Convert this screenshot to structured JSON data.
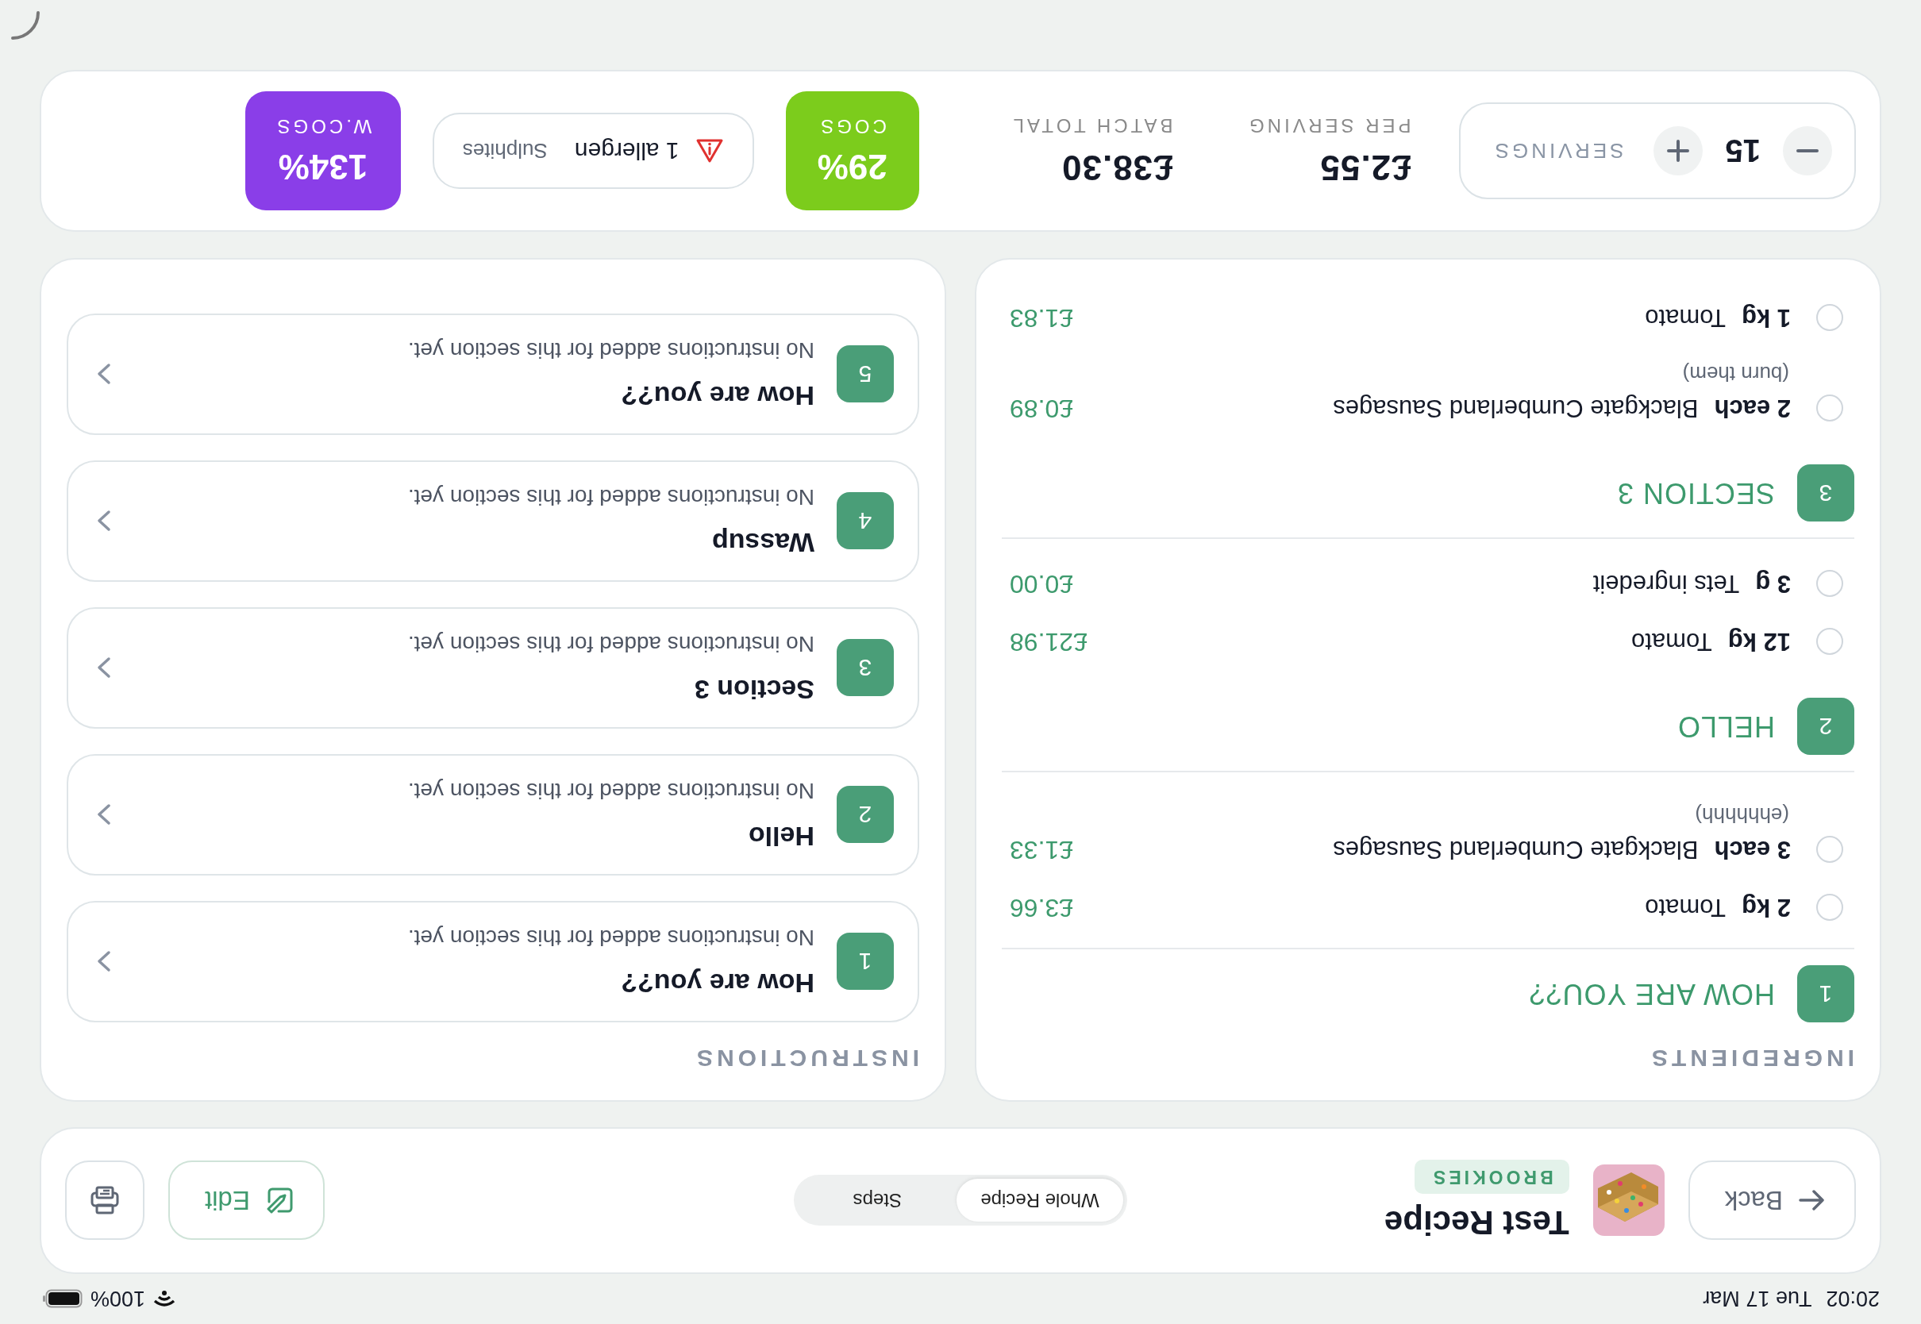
{
  "status_bar": {
    "time": "20:02",
    "date": "Tue 17 Mar",
    "battery": "100%"
  },
  "header": {
    "back": "Back",
    "category": "BROOKIES",
    "title": "Test Recipe",
    "view_tabs": [
      {
        "label": "Whole Recipe",
        "selected": true
      },
      {
        "label": "Steps",
        "selected": false
      }
    ],
    "edit": "Edit"
  },
  "ingredients": {
    "heading": "INGREDIENTS",
    "sections": [
      {
        "number": "1",
        "title": "HOW ARE YOU??",
        "items": [
          {
            "quantity": "2 kg",
            "name": "Tomato",
            "price": "£3.66",
            "checked": false
          },
          {
            "quantity": "3 each",
            "name": "Blackgate Cumberland Sausages",
            "note": "(ehhhhhh)",
            "price": "£1.33",
            "checked": false
          }
        ]
      },
      {
        "number": "2",
        "title": "HELLO",
        "items": [
          {
            "quantity": "12 kg",
            "name": "Tomato",
            "price": "£21.98",
            "checked": false
          },
          {
            "quantity": "3 g",
            "name": "Tets ingredeit",
            "price": "£0.00",
            "checked": false
          }
        ]
      },
      {
        "number": "3",
        "title": "SECTION 3",
        "items": [
          {
            "quantity": "2 each",
            "name": "Blackgate Cumberland Sausages",
            "note": "(burn them)",
            "price": "£0.89",
            "checked": false
          },
          {
            "quantity": "1 kg",
            "name": "Tomato",
            "price": "£1.83",
            "checked": false
          }
        ]
      }
    ]
  },
  "instructions": {
    "heading": "INSTRUCTIONS",
    "steps": [
      {
        "number": "1",
        "title": "How are you??",
        "text": "No instructions added for this section yet.",
        "expanded": false
      },
      {
        "number": "2",
        "title": "Hello",
        "text": "No instructions added for this section yet.",
        "expanded": false
      },
      {
        "number": "3",
        "title": "Section 3",
        "text": "No instructions added for this section yet.",
        "expanded": false
      },
      {
        "number": "4",
        "title": "Wassup",
        "text": "No instructions added for this section yet.",
        "expanded": false
      },
      {
        "number": "5",
        "title": "How are you??",
        "text": "No instructions added for this section yet.",
        "expanded": false
      }
    ]
  },
  "summary": {
    "servings": {
      "label": "SERVINGS",
      "value": "15"
    },
    "per_serving": {
      "label": "PER SERVING",
      "value": "£2.55"
    },
    "batch_total": {
      "label": "BATCH TOTAL",
      "value": "£38.30"
    },
    "cogs": {
      "label": "COGS",
      "value": "29%"
    },
    "allergens": {
      "count": "1 allergen",
      "names": "Sulphites"
    },
    "wcogs": {
      "label": "W.COGS",
      "value": "134%"
    }
  }
}
